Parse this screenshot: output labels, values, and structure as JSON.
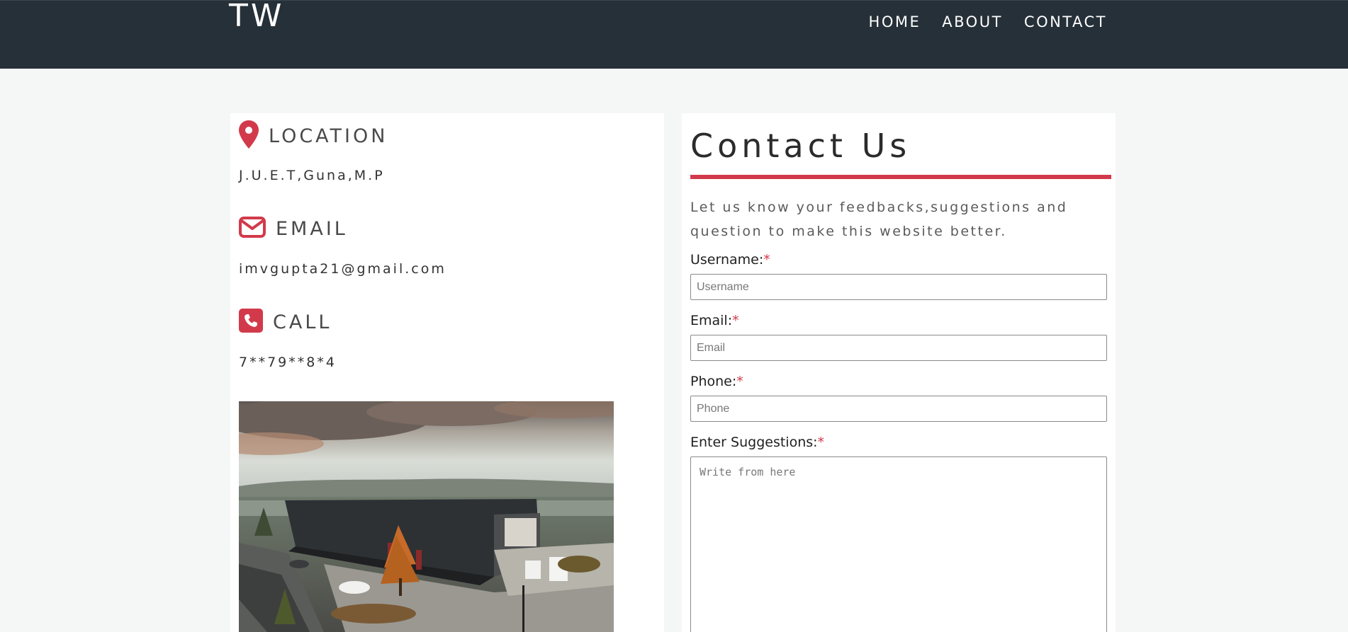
{
  "nav": {
    "brand": "TW",
    "links": [
      "HOME",
      "ABOUT",
      "CONTACT"
    ]
  },
  "info": {
    "location": {
      "icon": "map-marker-icon",
      "title": "LOCATION",
      "value": "J.U.E.T,Guna,M.P"
    },
    "email": {
      "icon": "envelope-icon",
      "title": "EMAIL",
      "value": "imvgupta21@gmail.com"
    },
    "call": {
      "icon": "phone-square-icon",
      "title": "CALL",
      "value": "7**79**8*4"
    }
  },
  "form": {
    "title": "Contact Us",
    "description": "Let us know your feedbacks,suggestions and question to make this website better.",
    "required_mark": "*",
    "fields": {
      "username": {
        "label": "Username:",
        "placeholder": "Username"
      },
      "email": {
        "label": "Email:",
        "placeholder": "Email"
      },
      "phone": {
        "label": "Phone:",
        "placeholder": "Phone"
      },
      "suggestions": {
        "label": "Enter Suggestions:",
        "placeholder": "Write from here"
      }
    }
  },
  "colors": {
    "navbar": "#263038",
    "accent": "#d23a4b",
    "page_bg": "#f5f6f6",
    "card_bg": "#ffffff"
  }
}
